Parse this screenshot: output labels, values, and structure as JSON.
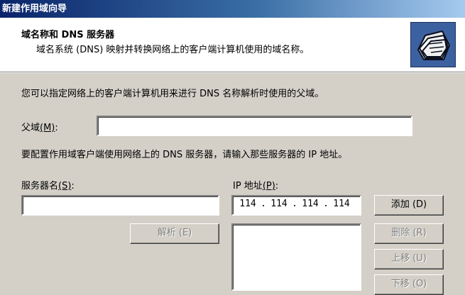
{
  "window": {
    "title": "新建作用域向导"
  },
  "header": {
    "title": "域名称和 DNS 服务器",
    "subtitle": "域名系统 (DNS) 映射并转换网络上的客户端计算机使用的域名称。",
    "icon": "folder-icon"
  },
  "body": {
    "intro": "您可以指定网络上的客户端计算机用来进行 DNS 名称解析时使用的父域。",
    "parent_domain": {
      "label": "父域",
      "hotkey": "(M)",
      "suffix": ":",
      "value": ""
    },
    "config_text": "要配置作用域客户端使用网络上的 DNS 服务器，请输入那些服务器的 IP 地址。",
    "server_name": {
      "label": "服务器名",
      "hotkey": "(S)",
      "suffix": ":",
      "value": ""
    },
    "ip_address": {
      "label": "IP 地址",
      "hotkey": "(P)",
      "suffix": ":",
      "octets": [
        "114",
        "114",
        "114",
        "114"
      ]
    },
    "buttons": {
      "resolve": "解析 (E)",
      "add": "添加 (D)",
      "remove": "删除 (R)",
      "move_up": "上移 (U)",
      "move_down": "下移 (O)"
    }
  }
}
